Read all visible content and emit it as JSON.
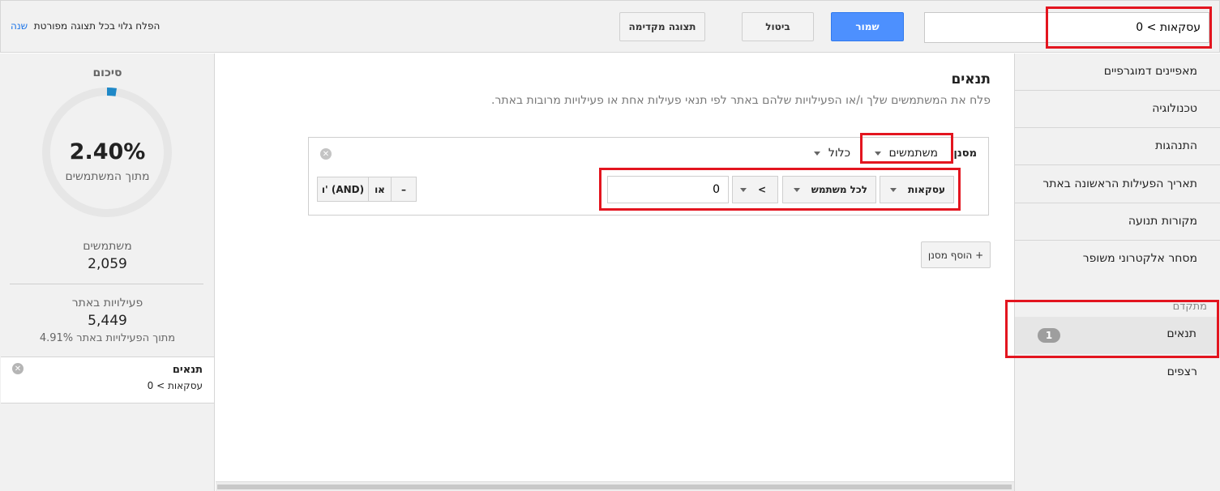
{
  "header": {
    "segment_name_value": "עסקאות > 0",
    "save_label": "שמור",
    "cancel_label": "ביטול",
    "preview_label": "תצוגה מקדימה",
    "visibility_text": "הפלח גלוי בכל תצוגה מפורטת",
    "change_link": "שנה"
  },
  "nav": {
    "items": [
      {
        "label": "מאפיינים דמוגרפיים"
      },
      {
        "label": "טכנולוגיה"
      },
      {
        "label": "התנהגות"
      },
      {
        "label": "תאריך הפעילות הראשונה באתר"
      },
      {
        "label": "מקורות תנועה"
      },
      {
        "label": "מסחר אלקטרוני משופר"
      }
    ],
    "advanced_header": "מתקדם",
    "advanced_items": [
      {
        "label": "תנאים",
        "badge": "1"
      },
      {
        "label": "רצפים"
      }
    ]
  },
  "main": {
    "title": "תנאים",
    "description": "פלח את המשתמשים שלך ו/או הפעילויות שלהם באתר לפי תנאי פעילות אחת או פעילויות מרובות באתר.",
    "filter": {
      "label": "מסנן",
      "scope_value": "משתמשים",
      "include_value": "כלול",
      "metric_value": "עסקאות",
      "aggregation_value": "לכל משתמש",
      "operator_value": ">",
      "value": "0",
      "and_label": "ו' (AND)",
      "or_label": "או",
      "remove_label": "–"
    },
    "add_filter_label": "+ הוסף מסנן"
  },
  "summary": {
    "title": "סיכום",
    "percent": "2.40%",
    "percent_sub": "מתוך המשתמשים",
    "percent_fraction": 0.024,
    "users_label": "משתמשים",
    "users_value": "2,059",
    "sessions_label": "פעילויות באתר",
    "sessions_value": "5,449",
    "sessions_sub": "4.91% מתוך הפעילויות באתר",
    "card_title": "תנאים",
    "card_value": "עסקאות > 0"
  },
  "colors": {
    "accent_blue": "#4d90fe",
    "highlight_red": "#e3151f",
    "donut_fill": "#1e88c7",
    "donut_track": "#e6e6e6"
  }
}
